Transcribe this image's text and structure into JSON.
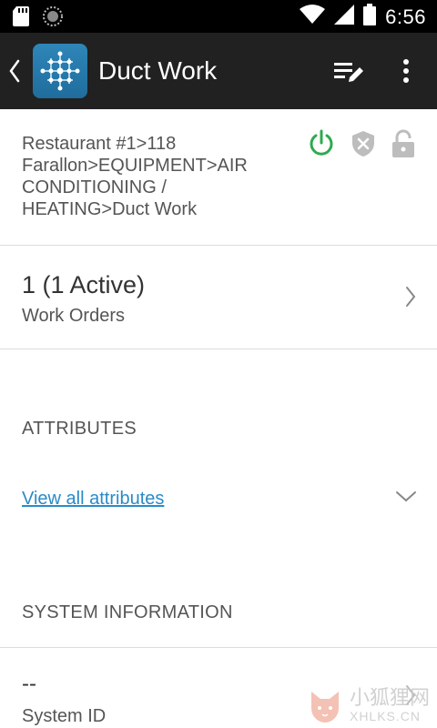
{
  "status_bar": {
    "time": "6:56"
  },
  "app_bar": {
    "title": "Duct Work"
  },
  "breadcrumb": {
    "text": "Restaurant #1>118 Farallon>EQUIPMENT>AIR CONDITIONING / HEATING>Duct Work"
  },
  "status_icons": {
    "power_color": "#2eaa4f",
    "inactive_color": "#bdbdbd"
  },
  "work_orders": {
    "count": "1 (1 Active)",
    "label": "Work Orders"
  },
  "attributes": {
    "header": "ATTRIBUTES",
    "link": "View all attributes"
  },
  "system_information": {
    "header": "SYSTEM INFORMATION",
    "system_id_value": "--",
    "system_id_label": "System ID"
  },
  "watermark": {
    "line1": "小狐狸网",
    "line2": "XHLKS.CN"
  }
}
